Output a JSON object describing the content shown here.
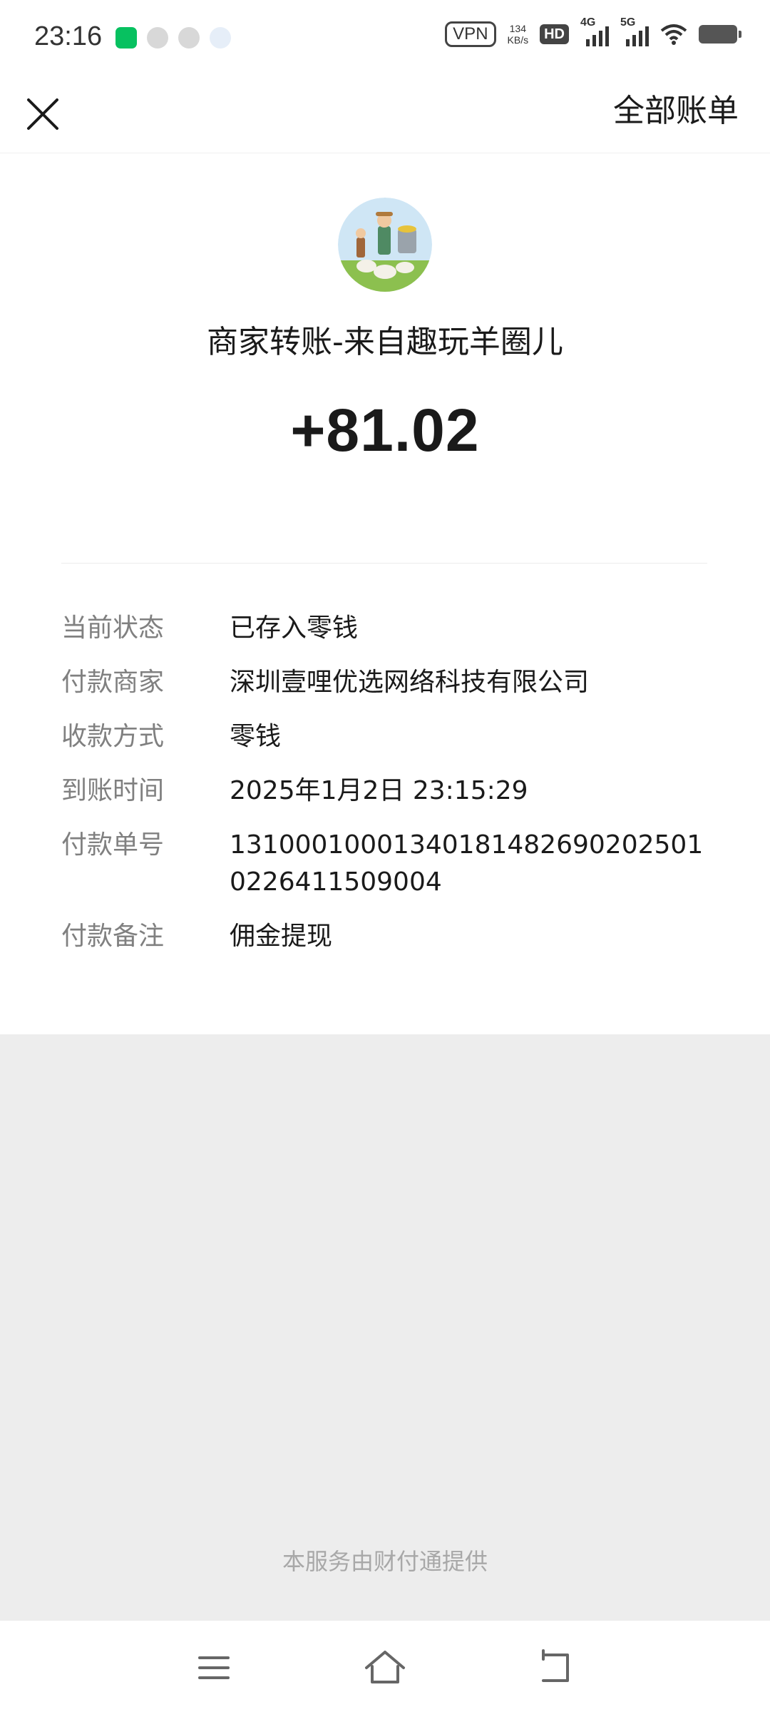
{
  "status_bar": {
    "time": "23:16",
    "vpn": "VPN",
    "net_speed_value": "134",
    "net_speed_unit": "KB/s",
    "hd": "HD",
    "sim1": "4G",
    "sim2": "5G",
    "icons": [
      "wechat-app-icon",
      "wechat-icon",
      "wechat-icon",
      "paw-icon",
      "wifi-icon",
      "battery-icon"
    ]
  },
  "nav": {
    "right_label": "全部账单",
    "close_icon": "close-icon"
  },
  "transaction": {
    "title": "商家转账-来自趣玩羊圈儿",
    "amount": "+81.02",
    "details": [
      {
        "label": "当前状态",
        "value": "已存入零钱"
      },
      {
        "label": "付款商家",
        "value": "深圳壹哩优选网络科技有限公司"
      },
      {
        "label": "收款方式",
        "value": "零钱"
      },
      {
        "label": "到账时间",
        "value": "2025年1月2日 23:15:29"
      },
      {
        "label": "付款单号",
        "value": "131000100013401814826902025010226411509004"
      },
      {
        "label": "付款备注",
        "value": "佣金提现"
      }
    ]
  },
  "footer": {
    "provider": "本服务由财付通提供"
  },
  "system_nav": {
    "icons": [
      "menu-icon",
      "home-icon",
      "back-icon"
    ]
  }
}
